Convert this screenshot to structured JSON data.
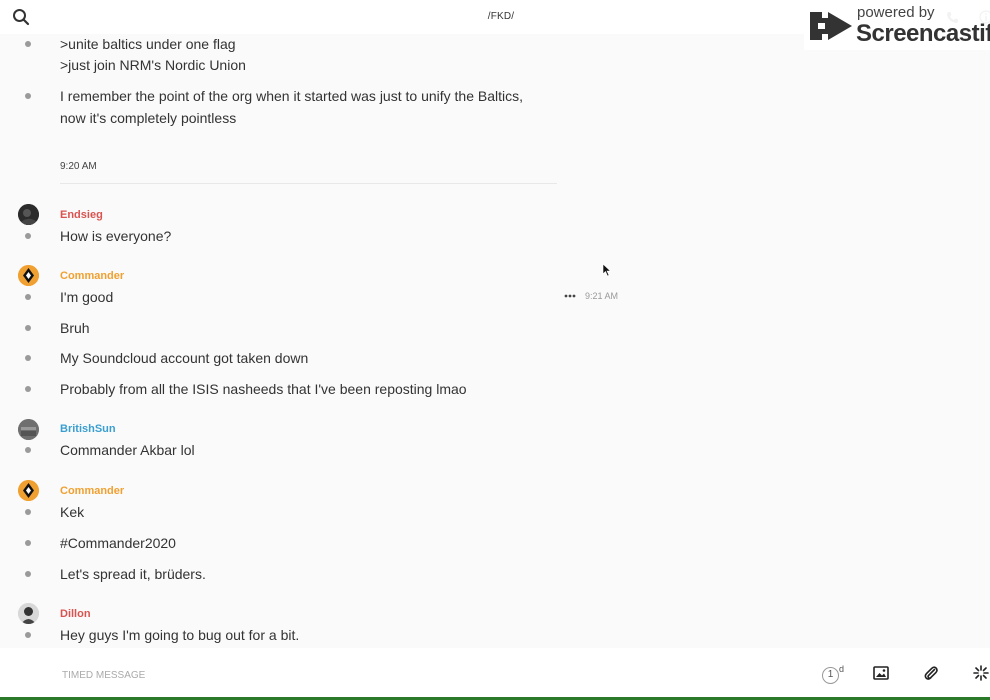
{
  "header": {
    "channel_title": "/FKD/"
  },
  "watermark": {
    "line1": "powered by",
    "line2": "Screencastify"
  },
  "messages_top": [
    {
      "text": ">unite baltics under one flag"
    },
    {
      "text": ">just join NRM's Nordic Union"
    },
    {
      "text": "I remember the point of the org when it started was just to unify the Baltics,"
    },
    {
      "text": "now it's completely pointless"
    }
  ],
  "time_separator": "9:20 AM",
  "groups": [
    {
      "user": "Endsieg",
      "messages": [
        "How is everyone?"
      ]
    },
    {
      "user": "Commander",
      "messages": [
        "I'm good",
        "Bruh",
        "My Soundcloud account got taken down",
        "Probably from all the ISIS nasheeds that I've been reposting lmao"
      ]
    },
    {
      "user": "BritishSun",
      "messages": [
        "Commander Akbar lol"
      ]
    },
    {
      "user": "Commander",
      "messages": [
        "Kek",
        "#Commander2020",
        "Let's spread it, brüders."
      ]
    },
    {
      "user": "Dillon",
      "messages": [
        "Hey guys I'm going to bug out for a bit."
      ]
    }
  ],
  "hover_timestamp": "9:21 AM",
  "composer": {
    "placeholder": "TIMED MESSAGE",
    "timer_value": "1",
    "timer_unit": "d"
  },
  "colors": {
    "username_red": "#d9534f",
    "username_orange": "#f0a030",
    "username_blue": "#3a9fd0"
  },
  "icons": [
    "search-icon",
    "phone-icon",
    "info-icon",
    "more-icon",
    "timer-icon",
    "image-icon",
    "paperclip-icon",
    "sparkle-icon"
  ]
}
